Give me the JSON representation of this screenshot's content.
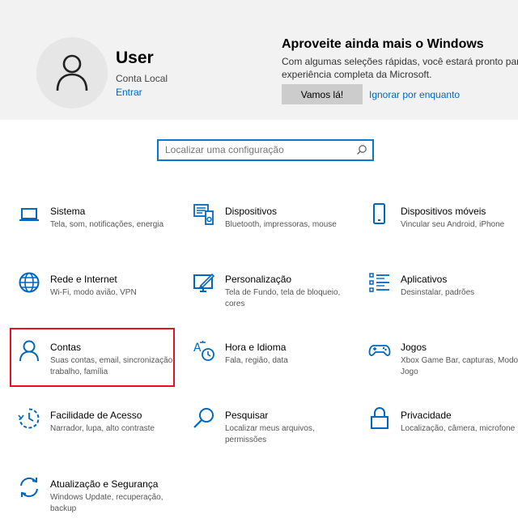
{
  "header": {
    "user": {
      "name": "User",
      "account_type": "Conta Local",
      "signin_link": "Entrar"
    },
    "promo": {
      "title": "Aproveite ainda mais o Windows",
      "text_line1": "Com algumas seleções rápidas, você estará pronto para apr",
      "text_line2": "experiência completa da Microsoft.",
      "primary_button": "Vamos lá!",
      "secondary_link": "Ignorar por enquanto"
    }
  },
  "search": {
    "placeholder": "Localizar uma configuração",
    "icon": "search-icon"
  },
  "accent_color": "#0078d7",
  "highlight_color": "#e81123",
  "categories": [
    {
      "title": "Sistema",
      "description": "Tela, som, notificações, energia",
      "icon": "laptop-icon"
    },
    {
      "title": "Dispositivos",
      "description": "Bluetooth, impressoras, mouse",
      "icon": "devices-icon"
    },
    {
      "title": "Dispositivos móveis",
      "description": "Vincular seu Android, iPhone",
      "icon": "phone-icon"
    },
    {
      "title": "Rede e Internet",
      "description": "Wi-Fi, modo avião, VPN",
      "icon": "globe-icon"
    },
    {
      "title": "Personalização",
      "description": "Tela de Fundo, tela de bloqueio, cores",
      "icon": "personalization-icon"
    },
    {
      "title": "Aplicativos",
      "description": "Desinstalar, padrões",
      "icon": "apps-list-icon"
    },
    {
      "title": "Contas",
      "description": "Suas contas, email, sincronização, trabalho, família",
      "icon": "person-icon"
    },
    {
      "title": "Hora e Idioma",
      "description": "Fala, região, data",
      "icon": "time-language-icon"
    },
    {
      "title": "Jogos",
      "description": "Xbox Game Bar, capturas, Modo de Jogo",
      "icon": "gamepad-icon"
    },
    {
      "title": "Facilidade de Acesso",
      "description": "Narrador, lupa, alto contraste",
      "icon": "ease-of-access-icon"
    },
    {
      "title": "Pesquisar",
      "description": "Localizar meus arquivos, permissões",
      "icon": "search-icon"
    },
    {
      "title": "Privacidade",
      "description": "Localização, câmera, microfone",
      "icon": "lock-icon"
    },
    {
      "title": "Atualização e Segurança",
      "description": "Windows Update, recuperação, backup",
      "icon": "sync-icon"
    }
  ]
}
